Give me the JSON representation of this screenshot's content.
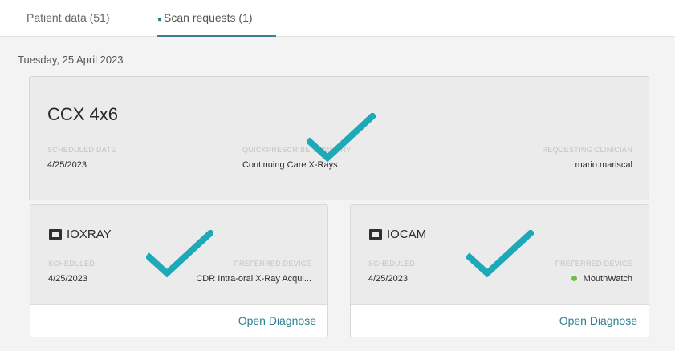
{
  "tabs": {
    "patient_data": "Patient data (51)",
    "scan_requests": "Scan requests (1)"
  },
  "date_heading": "Tuesday, 25 April 2023",
  "request": {
    "title": "CCX 4x6",
    "scheduled_date_label": "SCHEDULED DATE",
    "scheduled_date": "4/25/2023",
    "quickprescribe_label": "QUICKPRESCRIBE SUMMARY",
    "quickprescribe_value": "Continuing Care X-Rays",
    "clinician_label": "REQUESTING CLINICIAN",
    "clinician_value": "mario.mariscal"
  },
  "scans": [
    {
      "modality": "IOXRAY",
      "scheduled_label": "SCHEDULED",
      "scheduled_value": "4/25/2023",
      "device_label": "PREFERRED DEVICE",
      "device_value": "CDR Intra-oral X-Ray Acqui...",
      "action": "Open Diagnose"
    },
    {
      "modality": "IOCAM",
      "scheduled_label": "SCHEDULED",
      "scheduled_value": "4/25/2023",
      "device_label": "PREFERRED DEVICE",
      "device_value": "MouthWatch",
      "action": "Open Diagnose"
    }
  ],
  "colors": {
    "accent": "#2f7f93",
    "check": "#1ea8b8",
    "status_online": "#6cc04a"
  },
  "icons": {
    "check": "checkmark-icon",
    "modality": "device-icon"
  }
}
